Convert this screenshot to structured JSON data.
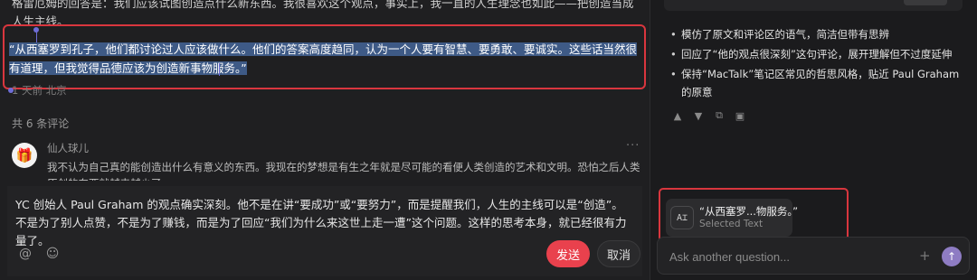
{
  "article": {
    "top_line": "格雷厄姆的回答是：我们应该试图创造点什么新东西。我很喜欢这个观点，事实上，我一直的人生理念也如此——把创造当成人生主线。",
    "selected_quote": "“从西塞罗到孔子，他们都讨论过人应该做什么。他们的答案高度趋同，认为一个人要有智慧、要勇敢、要诚实。这些话当然很有道理，但我觉得品德应该为创造新事物服务。”",
    "meta": "1 天前 北京"
  },
  "comments": {
    "count_label": "共 6 条评论",
    "items": [
      {
        "avatar_icon": "gift-icon",
        "name": "仙人球儿",
        "text": "我不认为自己真的能创造出什么有意义的东西。我现在的梦想是有生之年就是尽可能的看便人类创造的艺术和文明。恐怕之后人类原创的东西就越来越少了"
      }
    ]
  },
  "reply": {
    "text": "YC 创始人 Paul Graham 的观点确实深刻。他不是在讲“要成功”或“要努力”，而是提醒我们，人生的主线可以是“创造”。不是为了别人点赞，不是为了赚钱，而是为了回应“我们为什么来这世上走一遭”这个问题。这样的思考本身，就已经很有力量了。",
    "mention_icon": "at-icon",
    "emoji_icon": "smile-icon",
    "send_label": "发送",
    "cancel_label": "取消"
  },
  "assistant": {
    "bullets": [
      "模仿了原文和评论区的语气，简洁但带有思辨",
      "回应了“他的观点很深刻”这句评论，展开理解但不过度延伸",
      "保持“MacTalk”笔记区常见的哲思风格，贴近 Paul Graham 的原意"
    ],
    "actions": [
      "thumbs-up-icon",
      "thumbs-down-icon",
      "copy-icon",
      "image-icon"
    ],
    "context_chip": {
      "icon": "text-icon",
      "title": "“从西塞罗...物服务。”",
      "subtitle": "Selected Text"
    },
    "ask": {
      "placeholder": "Ask another question...",
      "plus_icon": "plus-icon",
      "submit_icon": "arrow-up-icon"
    }
  },
  "colors": {
    "highlight_border": "#d9363e",
    "selection": "#3e5a86",
    "send_button": "#e9414d",
    "submit_button": "#8e7cc3"
  }
}
